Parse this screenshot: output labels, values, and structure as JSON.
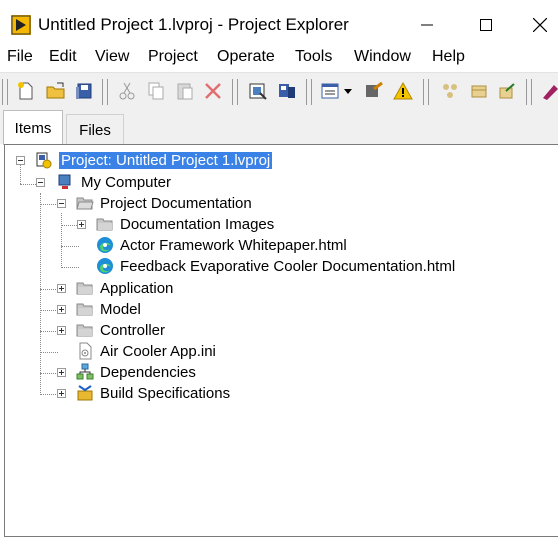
{
  "window": {
    "title": "Untitled Project 1.lvproj - Project Explorer"
  },
  "menu": [
    "File",
    "Edit",
    "View",
    "Project",
    "Operate",
    "Tools",
    "Window",
    "Help"
  ],
  "tabs": {
    "items": "Items",
    "files": "Files"
  },
  "tree": {
    "root": "Project: Untitled Project 1.lvproj",
    "my_computer": "My Computer",
    "project_documentation": "Project Documentation",
    "documentation_images": "Documentation Images",
    "actor_framework": "Actor Framework Whitepaper.html",
    "feedback_doc": "Feedback Evaporative Cooler Documentation.html",
    "application": "Application",
    "model": "Model",
    "controller": "Controller",
    "air_cooler_ini": "Air Cooler App.ini",
    "dependencies": "Dependencies",
    "build_specs": "Build Specifications"
  },
  "colors": {
    "selection": "#3b82e6",
    "folder": "#b8b8b8"
  }
}
